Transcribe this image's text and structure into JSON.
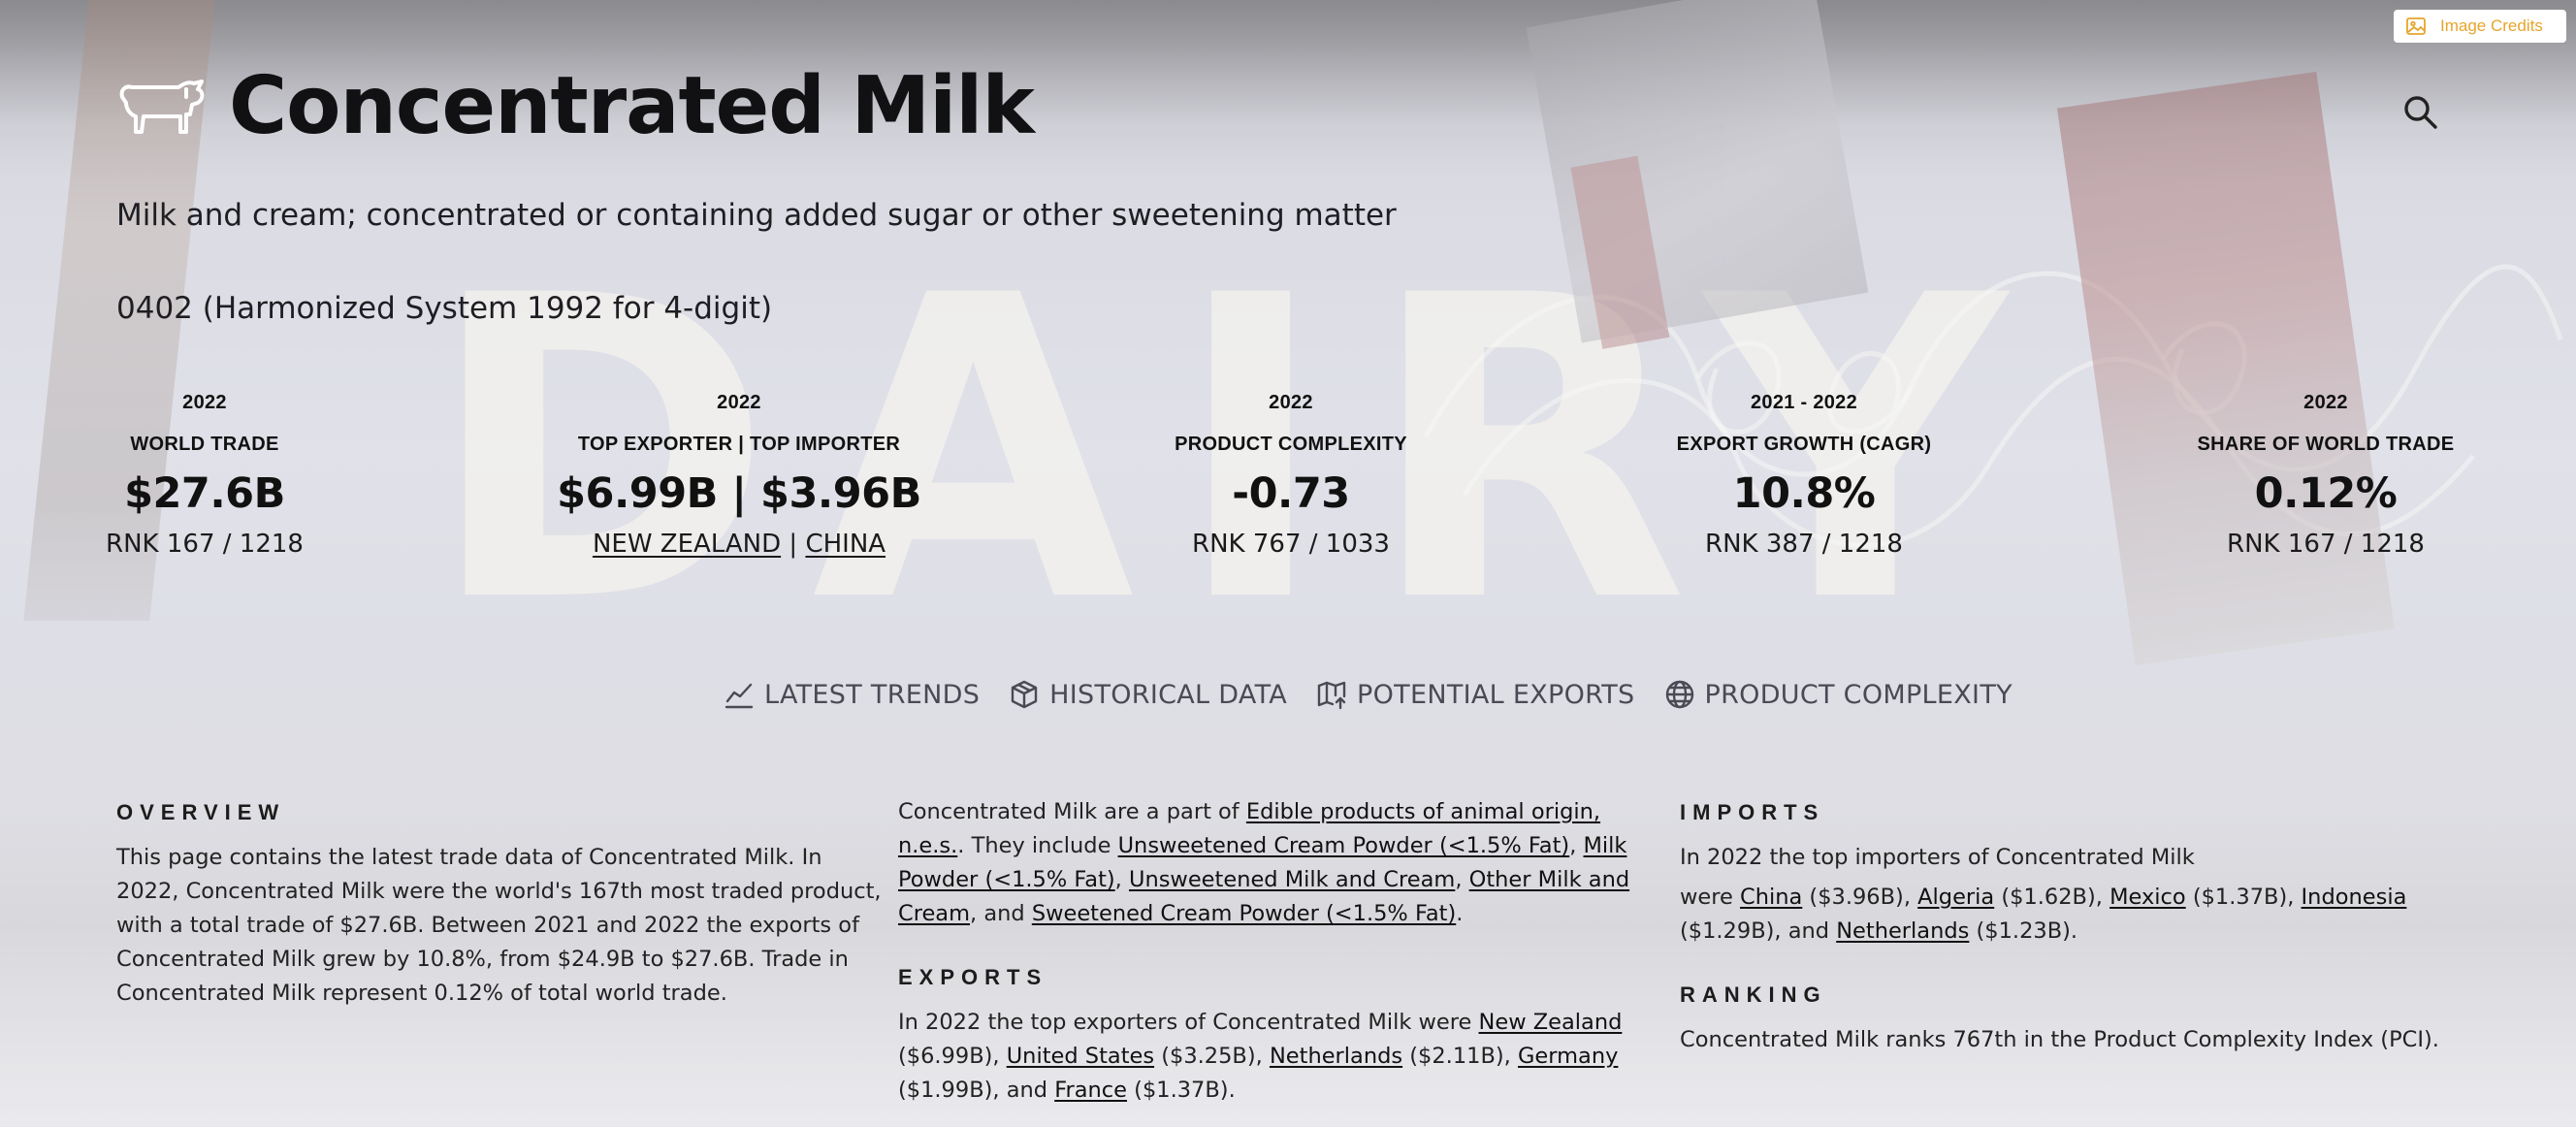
{
  "image_credits": {
    "label": "Image Credits"
  },
  "header": {
    "title": "Concentrated Milk"
  },
  "subtitle": "Milk and cream; concentrated or containing added sugar or other sweetening matter",
  "hs_code": "0402 (Harmonized System 1992 for 4-digit)",
  "stats": {
    "world_trade": {
      "year": "2022",
      "label": "WORLD TRADE",
      "value": "$27.6B",
      "rank": "RNK 167 / 1218"
    },
    "top_trade": {
      "year": "2022",
      "label": "TOP EXPORTER | TOP IMPORTER",
      "value": "$6.99B | $3.96B",
      "exporter": "NEW ZEALAND",
      "separator": "|",
      "importer": "CHINA"
    },
    "complexity": {
      "year": "2022",
      "label": "PRODUCT COMPLEXITY",
      "value": "-0.73",
      "rank": "RNK 767 / 1033"
    },
    "growth": {
      "year": "2021 - 2022",
      "label": "EXPORT GROWTH (CAGR)",
      "value": "10.8%",
      "rank": "RNK 387 / 1218"
    },
    "share": {
      "year": "2022",
      "label": "SHARE OF WORLD TRADE",
      "value": "0.12%",
      "rank": "RNK 167 / 1218"
    }
  },
  "tabs": [
    {
      "label": "LATEST TRENDS",
      "icon": "trend-line-icon"
    },
    {
      "label": "HISTORICAL DATA",
      "icon": "cube-icon"
    },
    {
      "label": "POTENTIAL EXPORTS",
      "icon": "map-icon"
    },
    {
      "label": "PRODUCT COMPLEXITY",
      "icon": "globe-icon"
    }
  ],
  "overview": {
    "heading": "OVERVIEW",
    "text": "This page contains the latest trade data of Concentrated Milk. In 2022, Concentrated Milk were the world's 167th most traded product, with a total trade of $27.6B. Between 2021 and 2022 the exports of Concentrated Milk grew by 10.8%, from $24.9B to $27.6B. Trade in Concentrated Milk represent 0.12% of total world trade."
  },
  "part_of": {
    "t1": "Concentrated Milk are a part of ",
    "parent": "Edible products of animal origin, n.e.s.",
    "t2": ". They include ",
    "c1": "Unsweetened Cream Powder (<1.5% Fat)",
    "s1": ", ",
    "c2": "Milk Powder (<1.5% Fat)",
    "s2": ", ",
    "c3": "Unsweetened Milk and Cream",
    "s3": ", ",
    "c4": "Other Milk and Cream",
    "s4": ", and ",
    "c5": "Sweetened Cream Powder (<1.5% Fat)",
    "end": "."
  },
  "exports": {
    "heading": "EXPORTS",
    "intro": "In 2022 the top exporters of Concentrated Milk  were ",
    "items": [
      {
        "country": "New Zealand",
        "value": " ($6.99B), "
      },
      {
        "country": "United States",
        "value": " ($3.25B), "
      },
      {
        "country": "Netherlands",
        "value": " ($2.11B), "
      },
      {
        "country": "Germany",
        "value": " ($1.99B), and "
      },
      {
        "country": "France",
        "value": " ($1.37B)."
      }
    ]
  },
  "imports": {
    "heading": "IMPORTS",
    "intro": "In 2022 the top importers of Concentrated Milk",
    "lead": "were ",
    "items": [
      {
        "country": "China",
        "value": " ($3.96B), "
      },
      {
        "country": "Algeria",
        "value": " ($1.62B), "
      },
      {
        "country": "Mexico",
        "value": " ($1.37B), "
      },
      {
        "country": "Indonesia",
        "value": " ($1.29B), and "
      },
      {
        "country": "Netherlands",
        "value": " ($1.23B)."
      }
    ]
  },
  "ranking": {
    "heading": "RANKING",
    "text": "Concentrated Milk ranks 767th in the Product Complexity Index (PCI)."
  },
  "background": {
    "sign_text": "DAIRY"
  }
}
